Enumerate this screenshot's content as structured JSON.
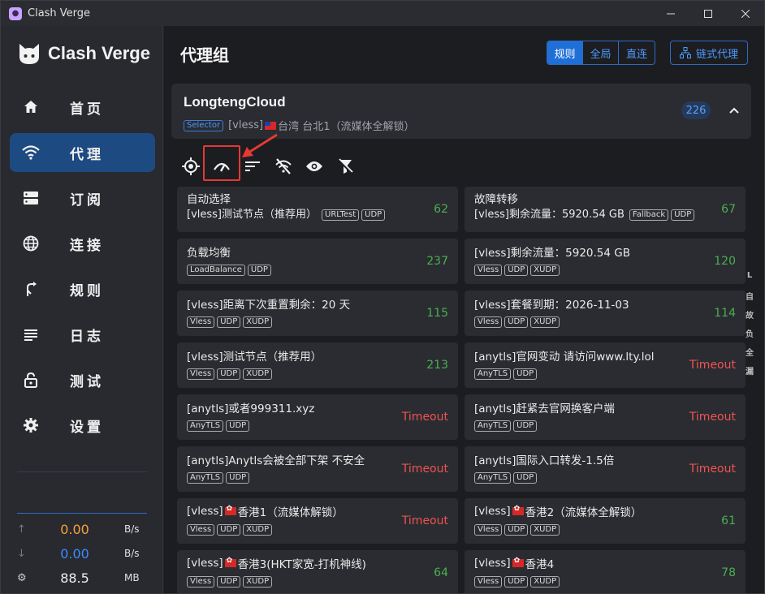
{
  "window": {
    "title": "Clash Verge"
  },
  "sidebar": {
    "logo_text": "Clash Verge",
    "items": [
      {
        "label": "首页",
        "icon": "home-icon"
      },
      {
        "label": "代理",
        "icon": "wifi-icon"
      },
      {
        "label": "订阅",
        "icon": "storage-icon"
      },
      {
        "label": "连接",
        "icon": "globe-icon"
      },
      {
        "label": "规则",
        "icon": "fork-icon"
      },
      {
        "label": "日志",
        "icon": "list-icon"
      },
      {
        "label": "测试",
        "icon": "lock-icon"
      },
      {
        "label": "设置",
        "icon": "gear-icon"
      }
    ],
    "traffic": {
      "up": {
        "value": "0.00",
        "unit": "B/s"
      },
      "down": {
        "value": "0.00",
        "unit": "B/s"
      },
      "memory": {
        "value": "88.5",
        "unit": "MB"
      }
    }
  },
  "header": {
    "title": "代理组",
    "modes": [
      "规则",
      "全局",
      "直连"
    ],
    "chain_button": "链式代理"
  },
  "group": {
    "name": "LongtengCloud",
    "type_badge": "Selector",
    "selected_prefix": "[vless]",
    "selected_name": "台湾 台北1（流媒体全解锁）",
    "count": "226"
  },
  "toolbar": [
    "locate-icon",
    "speed-test-icon",
    "sort-icon",
    "filter-off-icon",
    "eye-icon",
    "filter-clear-icon"
  ],
  "nodes": [
    {
      "name": "自动选择",
      "sub": "[vless]测试节点（推荐用）",
      "tags": [
        "URLTest",
        "UDP"
      ],
      "delay": "62",
      "status": "ok"
    },
    {
      "name": "故障转移",
      "sub": "[vless]剩余流量：5920.54 GB",
      "tags": [
        "Fallback",
        "UDP"
      ],
      "delay": "67",
      "status": "ok"
    },
    {
      "name": "负载均衡",
      "tags": [
        "LoadBalance",
        "UDP"
      ],
      "delay": "237",
      "status": "ok"
    },
    {
      "name": "[vless]剩余流量：5920.54 GB",
      "tags": [
        "Vless",
        "UDP",
        "XUDP"
      ],
      "delay": "120",
      "status": "ok"
    },
    {
      "name": "[vless]距离下次重置剩余：20 天",
      "tags": [
        "Vless",
        "UDP",
        "XUDP"
      ],
      "delay": "115",
      "status": "ok"
    },
    {
      "name": "[vless]套餐到期：2026-11-03",
      "tags": [
        "Vless",
        "UDP",
        "XUDP"
      ],
      "delay": "114",
      "status": "ok"
    },
    {
      "name": "[vless]测试节点（推荐用）",
      "tags": [
        "Vless",
        "UDP",
        "XUDP"
      ],
      "delay": "213",
      "status": "ok"
    },
    {
      "name": "[anytls]官网变动 请访问www.lty.lol",
      "tags": [
        "AnyTLS",
        "UDP"
      ],
      "delay": "Timeout",
      "status": "timeout"
    },
    {
      "name": "[anytls]或者999311.xyz",
      "tags": [
        "AnyTLS",
        "UDP"
      ],
      "delay": "Timeout",
      "status": "timeout"
    },
    {
      "name": "[anytls]赶紧去官网换客户端",
      "tags": [
        "AnyTLS",
        "UDP"
      ],
      "delay": "Timeout",
      "status": "timeout"
    },
    {
      "name": "[anytls]Anytls会被全部下架 不安全",
      "tags": [
        "AnyTLS",
        "UDP"
      ],
      "delay": "Timeout",
      "status": "timeout"
    },
    {
      "name": "[anytls]国际入口转发-1.5倍",
      "tags": [
        "AnyTLS",
        "UDP"
      ],
      "delay": "Timeout",
      "status": "timeout"
    },
    {
      "name": "[vless]",
      "flag": "hk",
      "name2": " 香港1（流媒体解锁）",
      "tags": [
        "Vless",
        "UDP",
        "XUDP"
      ],
      "delay": "Timeout",
      "status": "timeout"
    },
    {
      "name": "[vless]",
      "flag": "hk",
      "name2": " 香港2（流媒体全解锁）",
      "tags": [
        "Vless",
        "UDP",
        "XUDP"
      ],
      "delay": "61",
      "status": "ok"
    },
    {
      "name": "[vless]",
      "flag": "hk",
      "name2": " 香港3(HKT家宽-打机神线)",
      "tags": [
        "Vless",
        "UDP",
        "XUDP"
      ],
      "delay": "64",
      "status": "ok"
    },
    {
      "name": "[vless]",
      "flag": "hk",
      "name2": " 香港4",
      "tags": [
        "Vless",
        "UDP",
        "XUDP"
      ],
      "delay": "78",
      "status": "ok"
    }
  ],
  "index_letters": [
    "L",
    "自",
    "故",
    "负",
    "全",
    "漏"
  ]
}
